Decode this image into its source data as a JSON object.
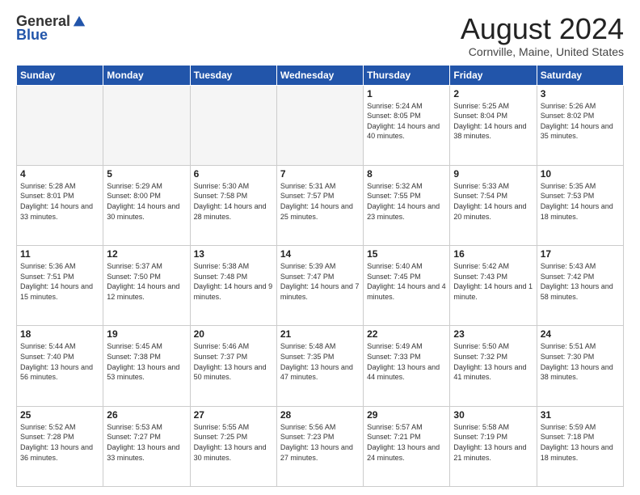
{
  "header": {
    "logo_general": "General",
    "logo_blue": "Blue",
    "month_title": "August 2024",
    "location": "Cornville, Maine, United States"
  },
  "weekdays": [
    "Sunday",
    "Monday",
    "Tuesday",
    "Wednesday",
    "Thursday",
    "Friday",
    "Saturday"
  ],
  "weeks": [
    [
      {
        "day": "",
        "empty": true
      },
      {
        "day": "",
        "empty": true
      },
      {
        "day": "",
        "empty": true
      },
      {
        "day": "",
        "empty": true
      },
      {
        "day": "1",
        "sunrise": "5:24 AM",
        "sunset": "8:05 PM",
        "daylight": "14 hours and 40 minutes."
      },
      {
        "day": "2",
        "sunrise": "5:25 AM",
        "sunset": "8:04 PM",
        "daylight": "14 hours and 38 minutes."
      },
      {
        "day": "3",
        "sunrise": "5:26 AM",
        "sunset": "8:02 PM",
        "daylight": "14 hours and 35 minutes."
      }
    ],
    [
      {
        "day": "4",
        "sunrise": "5:28 AM",
        "sunset": "8:01 PM",
        "daylight": "14 hours and 33 minutes."
      },
      {
        "day": "5",
        "sunrise": "5:29 AM",
        "sunset": "8:00 PM",
        "daylight": "14 hours and 30 minutes."
      },
      {
        "day": "6",
        "sunrise": "5:30 AM",
        "sunset": "7:58 PM",
        "daylight": "14 hours and 28 minutes."
      },
      {
        "day": "7",
        "sunrise": "5:31 AM",
        "sunset": "7:57 PM",
        "daylight": "14 hours and 25 minutes."
      },
      {
        "day": "8",
        "sunrise": "5:32 AM",
        "sunset": "7:55 PM",
        "daylight": "14 hours and 23 minutes."
      },
      {
        "day": "9",
        "sunrise": "5:33 AM",
        "sunset": "7:54 PM",
        "daylight": "14 hours and 20 minutes."
      },
      {
        "day": "10",
        "sunrise": "5:35 AM",
        "sunset": "7:53 PM",
        "daylight": "14 hours and 18 minutes."
      }
    ],
    [
      {
        "day": "11",
        "sunrise": "5:36 AM",
        "sunset": "7:51 PM",
        "daylight": "14 hours and 15 minutes."
      },
      {
        "day": "12",
        "sunrise": "5:37 AM",
        "sunset": "7:50 PM",
        "daylight": "14 hours and 12 minutes."
      },
      {
        "day": "13",
        "sunrise": "5:38 AM",
        "sunset": "7:48 PM",
        "daylight": "14 hours and 9 minutes."
      },
      {
        "day": "14",
        "sunrise": "5:39 AM",
        "sunset": "7:47 PM",
        "daylight": "14 hours and 7 minutes."
      },
      {
        "day": "15",
        "sunrise": "5:40 AM",
        "sunset": "7:45 PM",
        "daylight": "14 hours and 4 minutes."
      },
      {
        "day": "16",
        "sunrise": "5:42 AM",
        "sunset": "7:43 PM",
        "daylight": "14 hours and 1 minute."
      },
      {
        "day": "17",
        "sunrise": "5:43 AM",
        "sunset": "7:42 PM",
        "daylight": "13 hours and 58 minutes."
      }
    ],
    [
      {
        "day": "18",
        "sunrise": "5:44 AM",
        "sunset": "7:40 PM",
        "daylight": "13 hours and 56 minutes."
      },
      {
        "day": "19",
        "sunrise": "5:45 AM",
        "sunset": "7:38 PM",
        "daylight": "13 hours and 53 minutes."
      },
      {
        "day": "20",
        "sunrise": "5:46 AM",
        "sunset": "7:37 PM",
        "daylight": "13 hours and 50 minutes."
      },
      {
        "day": "21",
        "sunrise": "5:48 AM",
        "sunset": "7:35 PM",
        "daylight": "13 hours and 47 minutes."
      },
      {
        "day": "22",
        "sunrise": "5:49 AM",
        "sunset": "7:33 PM",
        "daylight": "13 hours and 44 minutes."
      },
      {
        "day": "23",
        "sunrise": "5:50 AM",
        "sunset": "7:32 PM",
        "daylight": "13 hours and 41 minutes."
      },
      {
        "day": "24",
        "sunrise": "5:51 AM",
        "sunset": "7:30 PM",
        "daylight": "13 hours and 38 minutes."
      }
    ],
    [
      {
        "day": "25",
        "sunrise": "5:52 AM",
        "sunset": "7:28 PM",
        "daylight": "13 hours and 36 minutes."
      },
      {
        "day": "26",
        "sunrise": "5:53 AM",
        "sunset": "7:27 PM",
        "daylight": "13 hours and 33 minutes."
      },
      {
        "day": "27",
        "sunrise": "5:55 AM",
        "sunset": "7:25 PM",
        "daylight": "13 hours and 30 minutes."
      },
      {
        "day": "28",
        "sunrise": "5:56 AM",
        "sunset": "7:23 PM",
        "daylight": "13 hours and 27 minutes."
      },
      {
        "day": "29",
        "sunrise": "5:57 AM",
        "sunset": "7:21 PM",
        "daylight": "13 hours and 24 minutes."
      },
      {
        "day": "30",
        "sunrise": "5:58 AM",
        "sunset": "7:19 PM",
        "daylight": "13 hours and 21 minutes."
      },
      {
        "day": "31",
        "sunrise": "5:59 AM",
        "sunset": "7:18 PM",
        "daylight": "13 hours and 18 minutes."
      }
    ]
  ]
}
